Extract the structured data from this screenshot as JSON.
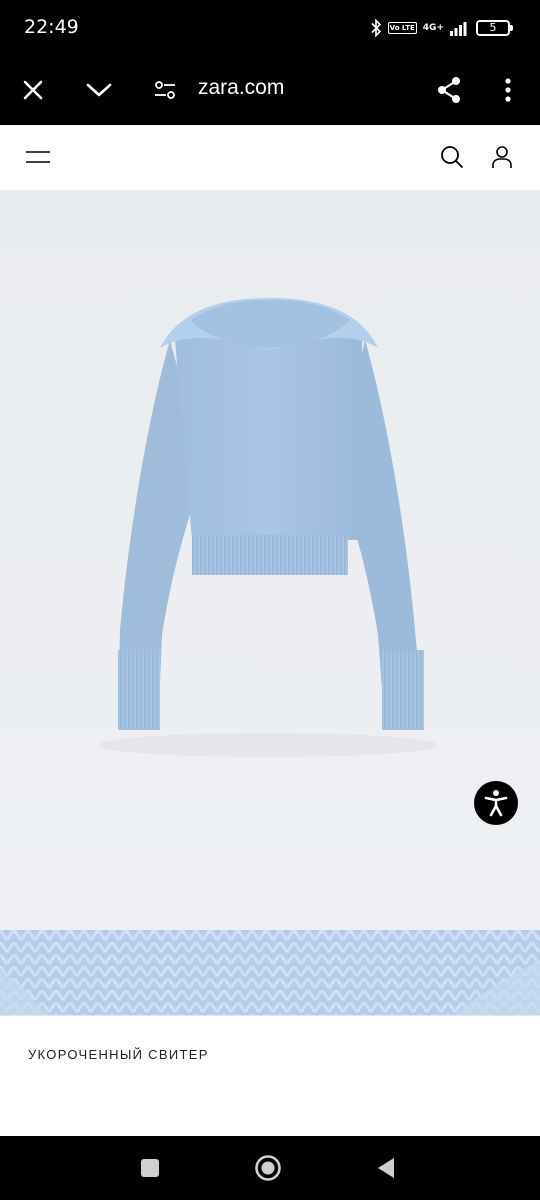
{
  "status_bar": {
    "time": "22:49",
    "network": "4G+",
    "volte": "Vo LTE",
    "battery": "5",
    "icons": [
      "bluetooth-icon",
      "volte-icon",
      "signal-icon",
      "battery-icon"
    ]
  },
  "browser": {
    "url": "zara.com",
    "icons": [
      "close-icon",
      "chevron-down-icon",
      "site-settings-icon",
      "share-icon",
      "more-vertical-icon"
    ]
  },
  "site_header": {
    "icons": [
      "hamburger-menu-icon",
      "search-icon",
      "user-icon"
    ]
  },
  "product": {
    "name": "УКОРОЧЕННЫЙ СВИТЕР",
    "color": "#a9c6e4"
  },
  "accessibility": {
    "icon": "accessibility-icon"
  },
  "nav_bar": {
    "icons": [
      "recent-apps-icon",
      "home-icon",
      "back-icon"
    ]
  }
}
